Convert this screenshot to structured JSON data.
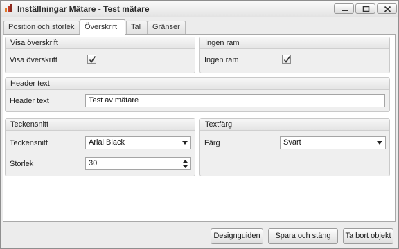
{
  "window": {
    "title": "Inställningar Mätare - Test mätare"
  },
  "tabs": [
    {
      "label": "Position och storlek"
    },
    {
      "label": "Överskrift"
    },
    {
      "label": "Tal"
    },
    {
      "label": "Gränser"
    }
  ],
  "active_tab": "Överskrift",
  "groups": {
    "visa_overskrift": {
      "title": "Visa överskrift",
      "label": "Visa överskrift",
      "checked": true
    },
    "ingen_ram": {
      "title": "Ingen ram",
      "label": "Ingen ram",
      "checked": true
    },
    "header_text": {
      "title": "Header text",
      "label": "Header text",
      "value": "Test av mätare"
    },
    "teckensnitt": {
      "title": "Teckensnitt",
      "font_label": "Teckensnitt",
      "font_value": "Arial Black",
      "size_label": "Storlek",
      "size_value": "30"
    },
    "textfarg": {
      "title": "Textfärg",
      "color_label": "Färg",
      "color_value": "Svart"
    }
  },
  "buttons": {
    "designguiden": "Designguiden",
    "spara": "Spara och stäng",
    "ta_bort": "Ta bort objekt"
  }
}
